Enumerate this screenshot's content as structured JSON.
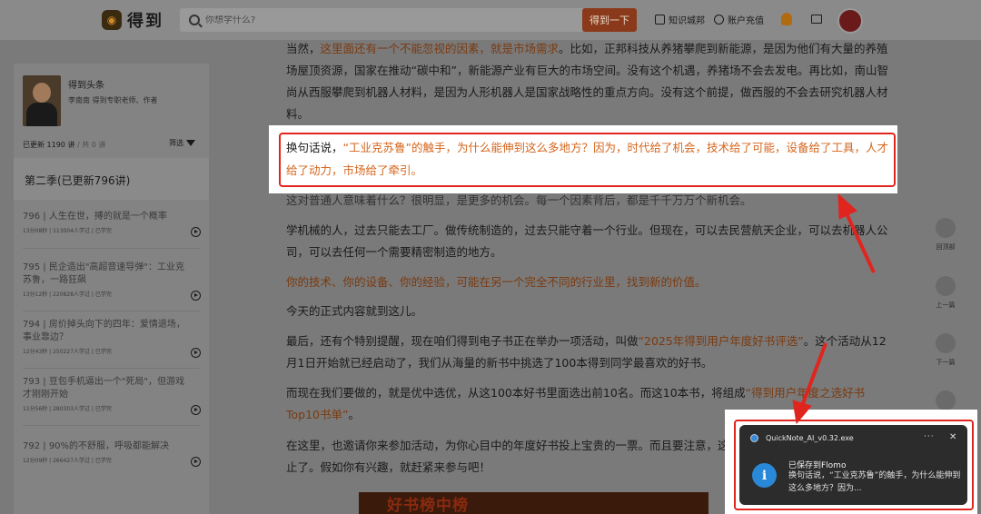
{
  "header": {
    "logo_text": "得到",
    "search_placeholder": "你想学什么?",
    "search_button": "得到一下",
    "link_knowledge": "知识城邦",
    "link_recharge": "账户充值"
  },
  "sidebar": {
    "author_name": "得到头条",
    "author_desc": "李南南 得到专职老师、作者",
    "updated_count": "已更新 1190 讲",
    "total": "共 0 讲",
    "filter_label": "筛选",
    "season_title": "第二季(已更新796讲)",
    "episodes": [
      {
        "title": "796 | 人生在世，搏的就是一个概率",
        "meta": "13分08秒 | 113004人学过 | 已学完"
      },
      {
        "title": "795 | 民企造出\"高超音速导弹\"：工业克苏鲁，一路狂飙",
        "meta": "13分12秒 | 220828人学过 | 已学完"
      },
      {
        "title": "794 | 房价掉头向下的四年：爱情退场，事业靠边？",
        "meta": "12分43秒 | 250227人学过 | 已学完"
      },
      {
        "title": "793 | 豆包手机逼出一个\"死局\"，但游戏才刚刚开始",
        "meta": "11分56秒 | 280303人学过 | 已学完"
      },
      {
        "title": "792 | 90%的不舒服，呼吸都能解决",
        "meta": "12分09秒 | 266427人学过 | 已学完"
      }
    ]
  },
  "article": {
    "p1_a": "当然，",
    "p1_hl": "这里面还有一个不能忽视的因素，就是市场需求",
    "p1_b": "。比如，正邦科技从养猪攀爬到新能源，是因为他们有大量的养殖场屋顶资源，国家在推动“碳中和”，新能源产业有巨大的市场空间。没有这个机遇，养猪场不会去发电。再比如，南山智尚从西服攀爬到机器人材料，是因为人形机器人是国家战略性的重点方向。没有这个前提，做西服的不会去研究机器人材料。",
    "quote_a": "换句话说，",
    "quote_hl": "“工业克苏鲁”的触手，为什么能伸到这么多地方？因为，时代给了机会，技术给了可能，设备给了工具，人才给了动力，市场给了牵引。",
    "p2": "这对普通人意味着什么？很明显，是更多的机会。每一个因素背后，都是千千万万个新机会。",
    "p3": "学机械的人，过去只能去工厂。做传统制造的，过去只能守着一个行业。但现在，可以去民营航天企业，可以去机器人公司，可以去任何一个需要精密制造的地方。",
    "p4": "你的技术、你的设备、你的经验，可能在另一个完全不同的行业里，找到新的价值。",
    "p5": "今天的正式内容就到这儿。",
    "p6_a": "最后，还有个特别提醒，现在咱们得到电子书正在举办一项活动，叫做",
    "p6_hl": "“2025年得到用户年度好书评选”",
    "p6_b": "。这个活动从12月1日开始就已经启动了，我们从海量的新书中挑选了100本得到同学最喜欢的好书。",
    "p7_a": "而现在我们要做的，就是优中选优，从这100本好书里面选出前10名。而这10本书，将组成",
    "p7_hl": "“得到用户年度之选好书Top10书单”",
    "p7_b": "。",
    "p8": "在这里，也邀请你来参加活动，为你心目中的年度好书投上宝贵的一票。而且要注意，这个活动在12月8日24点就正式截止了。假如你有兴趣，就赶紧来参与吧！",
    "banner_text": "好书榜中榜"
  },
  "side_nav": {
    "top": "回顶部",
    "prev": "上一篇",
    "next": "下一篇",
    "notes": "留言"
  },
  "notification": {
    "app_name": "QuickNote_AI_v0.32.exe",
    "more": "···",
    "close": "✕",
    "title": "已保存到Flomo",
    "body": "换句话说，“工业克苏鲁”的触手，为什么能伸到这么多地方？因为..."
  },
  "colors": {
    "highlight_orange": "#d5651c",
    "annotation_red": "#e0251f",
    "notification_bg": "#2c2c2c",
    "info_blue": "#2a88d8"
  }
}
